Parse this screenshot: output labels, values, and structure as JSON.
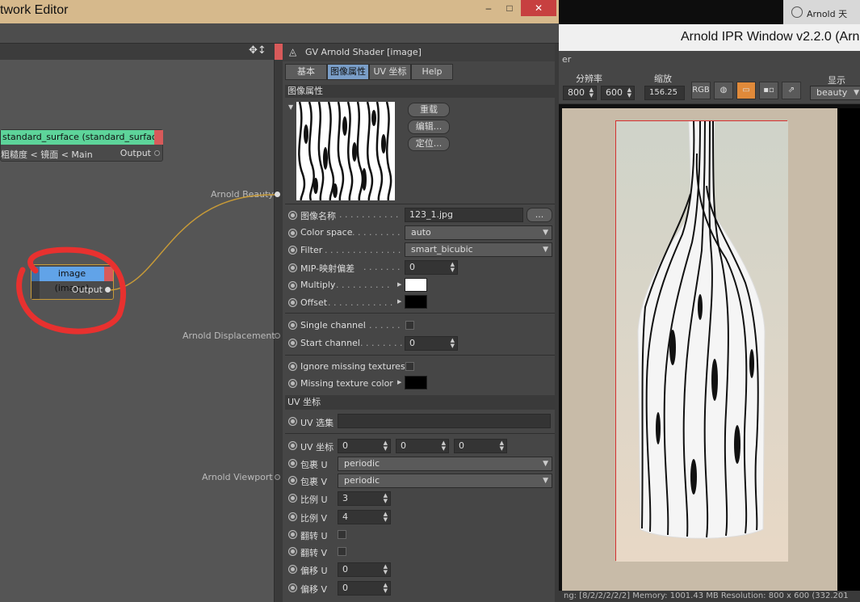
{
  "node_editor": {
    "title": "twork Editor",
    "window_buttons": {
      "minimize": "–",
      "maximize": "□",
      "close": "✕"
    }
  },
  "canvas": {
    "nav_icons": "✥↕",
    "node_standard_surface": {
      "title": "standard_surface (standard_surface)",
      "row_left": "粗糙度 < 镜面 < Main",
      "row_right": "Output"
    },
    "node_image": {
      "title": "image (image)",
      "output": "Output"
    },
    "labels": {
      "beauty": "Arnold Beauty",
      "displacement": "Arnold Displacement",
      "viewport": "Arnold Viewport"
    }
  },
  "panel": {
    "header": "GV Arnold Shader [image]",
    "tabs": [
      "基本",
      "图像属性",
      "UV 坐标",
      "Help"
    ],
    "active_tab": "图像属性",
    "image_section": "图像属性",
    "buttons": {
      "reload": "重载",
      "edit": "编辑...",
      "locate": "定位..."
    },
    "params": {
      "image_name": {
        "label": "图像名称",
        "value": "123_1.jpg",
        "browse": "..."
      },
      "color_space": {
        "label": "Color space",
        "value": "auto"
      },
      "filter": {
        "label": "Filter",
        "value": "smart_bicubic"
      },
      "mip_bias": {
        "label": "MIP-映射偏差",
        "value": "0"
      },
      "multiply": {
        "label": "Multiply",
        "color": "#ffffff"
      },
      "offset": {
        "label": "Offset",
        "color": "#000000"
      },
      "single_channel": {
        "label": "Single channel"
      },
      "start_channel": {
        "label": "Start channel",
        "value": "0"
      },
      "ignore_missing": {
        "label": "Ignore missing textures"
      },
      "missing_color": {
        "label": "Missing texture color",
        "color": "#000000"
      }
    },
    "uv_section": "UV 坐标",
    "uv": {
      "uv_set": {
        "label": "UV 选集",
        "value": ""
      },
      "uv_coords": {
        "label": "UV 坐标",
        "values": [
          "0",
          "0",
          "0"
        ]
      },
      "wrap_u": {
        "label": "包裹 U",
        "value": "periodic"
      },
      "wrap_v": {
        "label": "包裹 V",
        "value": "periodic"
      },
      "scale_u": {
        "label": "比例 U",
        "value": "3"
      },
      "scale_v": {
        "label": "比例 V",
        "value": "4"
      },
      "flip_u": {
        "label": "翻转 U"
      },
      "flip_v": {
        "label": "翻转 V"
      },
      "offset_u": {
        "label": "偏移 U",
        "value": "0"
      },
      "offset_v": {
        "label": "偏移 V",
        "value": "0"
      }
    }
  },
  "ipr": {
    "tree_item": "Arnold 天",
    "title": "Arnold IPR Window v2.2.0 (Arn",
    "menu_fragment": "er",
    "groups": {
      "resolution": "分辨率",
      "zoom": "缩放",
      "display": "显示"
    },
    "res_w": "800",
    "res_h": "600",
    "zoom_val": "156.25",
    "rgb_label": "RGB",
    "aov": "beauty",
    "status": "ng: [8/2/2/2/2/2]  Memory: 1001.43 MB  Resolution: 800 x 600 (332.201"
  },
  "colors": {
    "node_green": "#5dd49a",
    "node_blue": "#61a3e8",
    "port_red": "#d85a5a",
    "wire": "#c79a38",
    "annotation_red": "#e8312f",
    "active_tab": "#7a9ec8"
  }
}
